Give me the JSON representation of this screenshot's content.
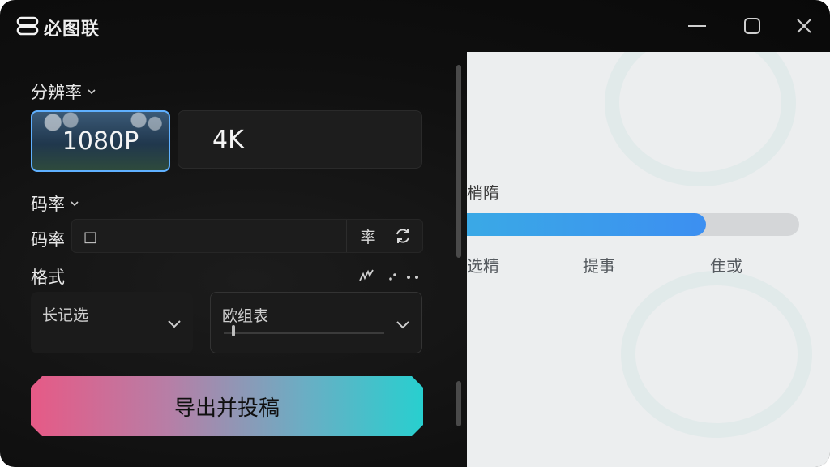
{
  "app": {
    "title": "必图联"
  },
  "window_controls": {
    "minimize": "minimize",
    "maximize": "maximize",
    "close": "close"
  },
  "settings": {
    "resolution": {
      "label": "分辨率",
      "options": [
        {
          "label": "1080P",
          "selected": true
        },
        {
          "label": "4K",
          "selected": false
        }
      ]
    },
    "bitrate": {
      "section_label": "码率",
      "field_label": "码率",
      "value": "□",
      "unit": "率"
    },
    "format": {
      "label": "格式",
      "dropdown1_value": "长记选",
      "dropdown2_value": "欧组表",
      "dropdown2_level": 0.05
    },
    "export_button": "导出并投稿"
  },
  "preview": {
    "status_text": "梢隋",
    "progress": 0.72,
    "steps": [
      "选精",
      "提事",
      "隹或"
    ]
  },
  "colors": {
    "accent_blue": "#3c8ff1",
    "selection_border": "#5fb0ff",
    "export_gradient_start": "#e65a86",
    "export_gradient_end": "#28cfcf"
  }
}
